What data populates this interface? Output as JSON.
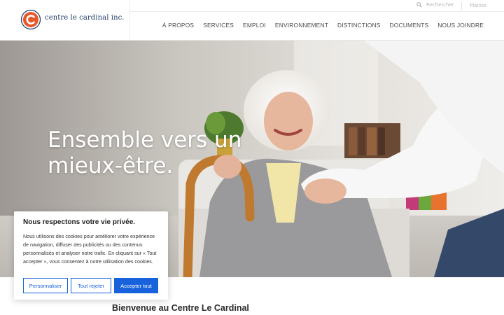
{
  "header": {
    "logo_text": "centre le cardinal inc.",
    "search_placeholder": "Rechercher",
    "complaint_link": "Plainte",
    "nav": [
      "À PROPOS",
      "SERVICES",
      "EMPLOI",
      "ENVIRONNEMENT",
      "DISTINCTIONS",
      "DOCUMENTS",
      "NOUS JOINDRE"
    ]
  },
  "hero": {
    "title_line1": "Ensemble vers un",
    "title_line2": "mieux-être."
  },
  "cookie_banner": {
    "title": "Nous respectons votre vie privée.",
    "body": "Nous utilisons des cookies pour améliorer votre expérience de navigation, diffuser des publicités ou des contenus personnalisés et analyser notre trafic. En cliquant sur « Tout accepter », vous consentez à notre utilisation des cookies.",
    "customize_label": "Personnaliser",
    "reject_label": "Tout rejeter",
    "accept_label": "Accepter tout"
  },
  "welcome_heading": "Bienvenue au Centre Le Cardinal",
  "colors": {
    "brand_orange": "#e8572a",
    "brand_navy": "#1e3a66",
    "accent_blue": "#1863dc"
  },
  "icons": {
    "logo": "cardinal-circle-logo",
    "search": "search-icon"
  }
}
